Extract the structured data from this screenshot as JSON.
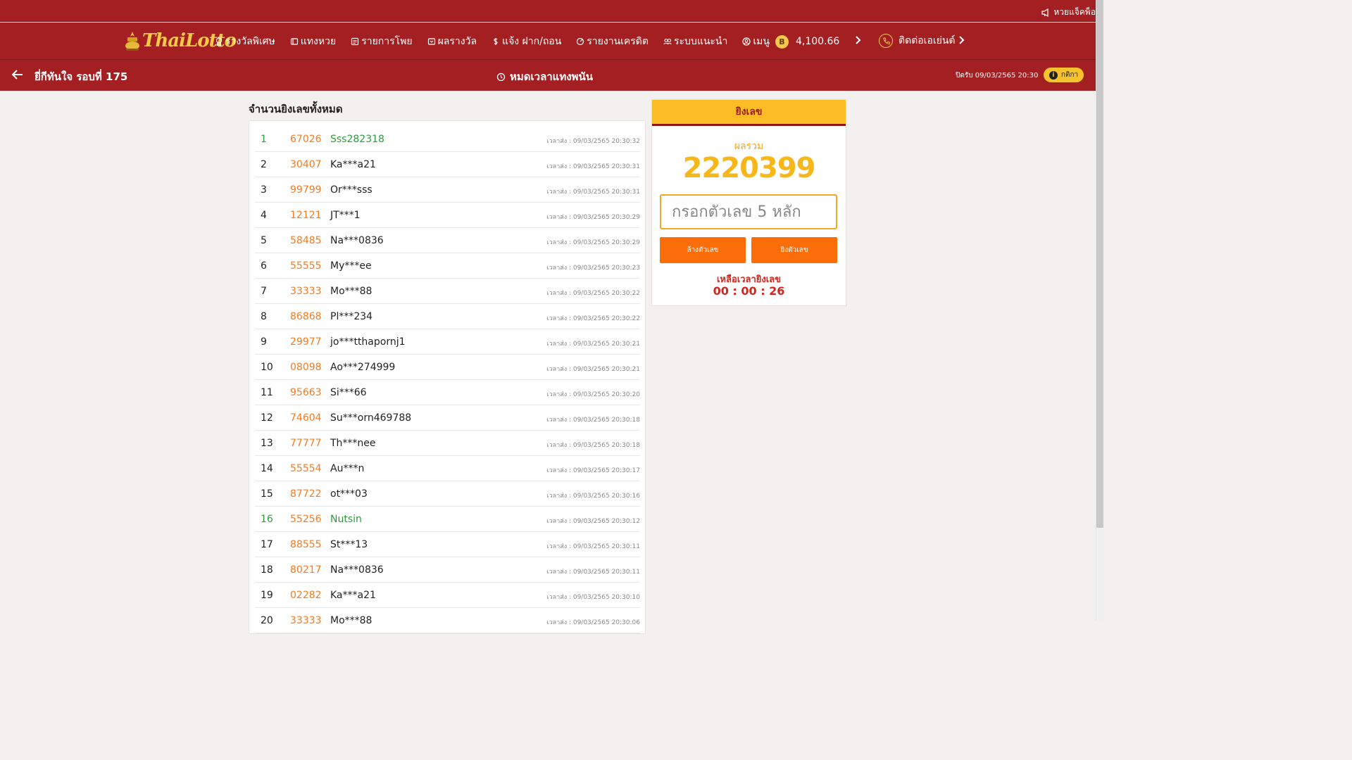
{
  "topbar": {
    "marquee": "หวยแจ็คพ็อ"
  },
  "brand": {
    "logo_text": "ThaiLotto"
  },
  "nav": {
    "items": [
      {
        "label": "รางวัลพิเศษ",
        "icon": "award-icon"
      },
      {
        "label": "แทงหวย",
        "icon": "ticket-icon"
      },
      {
        "label": "รายการโพย",
        "icon": "list-icon"
      },
      {
        "label": "ผลรางวัล",
        "icon": "trophy-icon"
      },
      {
        "label": "แจ้ง ฝาก/ถอน",
        "icon": "money-icon"
      },
      {
        "label": "รายงานเครดิต",
        "icon": "report-icon"
      },
      {
        "label": "ระบบแนะนำ",
        "icon": "users-icon"
      },
      {
        "label": "เมนู",
        "icon": "user-circle-icon"
      }
    ],
    "balance_symbol": "B",
    "balance": "4,100.66",
    "contact_label": "ติดต่อเอเย่นต์"
  },
  "subheader": {
    "round_title": "ยี่กีทันใจ รอบที่ 175",
    "status": "หมดเวลาแทงพนัน",
    "close_time": "ปิดรับ 09/03/2565 20:30",
    "rules_label": "กติกา"
  },
  "list": {
    "title": "จำนวนยิงเลขทั้งหมด",
    "time_prefix": "เวลาส่ง : ",
    "rows": [
      {
        "idx": "1",
        "num": "67026",
        "user": "Sss282318",
        "time": "เวลาส่ง : 09/03/2565 20:30:32",
        "highlight": true
      },
      {
        "idx": "2",
        "num": "30407",
        "user": "Ka***a21",
        "time": "เวลาส่ง : 09/03/2565 20:30:31",
        "highlight": false
      },
      {
        "idx": "3",
        "num": "99799",
        "user": "Or***sss",
        "time": "เวลาส่ง : 09/03/2565 20:30:31",
        "highlight": false
      },
      {
        "idx": "4",
        "num": "12121",
        "user": "JT***1",
        "time": "เวลาส่ง : 09/03/2565 20:30:29",
        "highlight": false
      },
      {
        "idx": "5",
        "num": "58485",
        "user": "Na***0836",
        "time": "เวลาส่ง : 09/03/2565 20:30:29",
        "highlight": false
      },
      {
        "idx": "6",
        "num": "55555",
        "user": "My***ee",
        "time": "เวลาส่ง : 09/03/2565 20:30:23",
        "highlight": false
      },
      {
        "idx": "7",
        "num": "33333",
        "user": "Mo***88",
        "time": "เวลาส่ง : 09/03/2565 20:30:22",
        "highlight": false
      },
      {
        "idx": "8",
        "num": "86868",
        "user": "Pl***234",
        "time": "เวลาส่ง : 09/03/2565 20:30:22",
        "highlight": false
      },
      {
        "idx": "9",
        "num": "29977",
        "user": "jo***tthapornj1",
        "time": "เวลาส่ง : 09/03/2565 20:30:21",
        "highlight": false
      },
      {
        "idx": "10",
        "num": "08098",
        "user": "Ao***274999",
        "time": "เวลาส่ง : 09/03/2565 20:30:21",
        "highlight": false
      },
      {
        "idx": "11",
        "num": "95663",
        "user": "Si***66",
        "time": "เวลาส่ง : 09/03/2565 20:30:20",
        "highlight": false
      },
      {
        "idx": "12",
        "num": "74604",
        "user": "Su***orn469788",
        "time": "เวลาส่ง : 09/03/2565 20:30:18",
        "highlight": false
      },
      {
        "idx": "13",
        "num": "77777",
        "user": "Th***nee",
        "time": "เวลาส่ง : 09/03/2565 20:30:18",
        "highlight": false
      },
      {
        "idx": "14",
        "num": "55554",
        "user": "Au***n",
        "time": "เวลาส่ง : 09/03/2565 20:30:17",
        "highlight": false
      },
      {
        "idx": "15",
        "num": "87722",
        "user": "ot***03",
        "time": "เวลาส่ง : 09/03/2565 20:30:16",
        "highlight": false
      },
      {
        "idx": "16",
        "num": "55256",
        "user": "Nutsin",
        "time": "เวลาส่ง : 09/03/2565 20:30:12",
        "highlight": true
      },
      {
        "idx": "17",
        "num": "88555",
        "user": "St***13",
        "time": "เวลาส่ง : 09/03/2565 20:30:11",
        "highlight": false
      },
      {
        "idx": "18",
        "num": "80217",
        "user": "Na***0836",
        "time": "เวลาส่ง : 09/03/2565 20:30:11",
        "highlight": false
      },
      {
        "idx": "19",
        "num": "02282",
        "user": "Ka***a21",
        "time": "เวลาส่ง : 09/03/2565 20:30:10",
        "highlight": false
      },
      {
        "idx": "20",
        "num": "33333",
        "user": "Mo***88",
        "time": "เวลาส่ง : 09/03/2565 20:30:06",
        "highlight": false
      }
    ]
  },
  "shoot": {
    "header": "ยิงเลข",
    "sum_label": "ผลรวม",
    "sum_value": "2220399",
    "input_placeholder": "กรอกตัวเลข 5 หลัก",
    "btn_clear": "ล้างตัวเลข",
    "btn_send": "ยิงตัวเลข",
    "remain_label": "เหลือเวลายิงเลข",
    "remain_time": "00 : 00 : 26"
  },
  "colors": {
    "header_red": "#a31f22",
    "accent_orange": "#fa6d08",
    "gold": "#f7b719",
    "number_orange": "#f47a20",
    "highlight_green": "#2e9b3a"
  }
}
